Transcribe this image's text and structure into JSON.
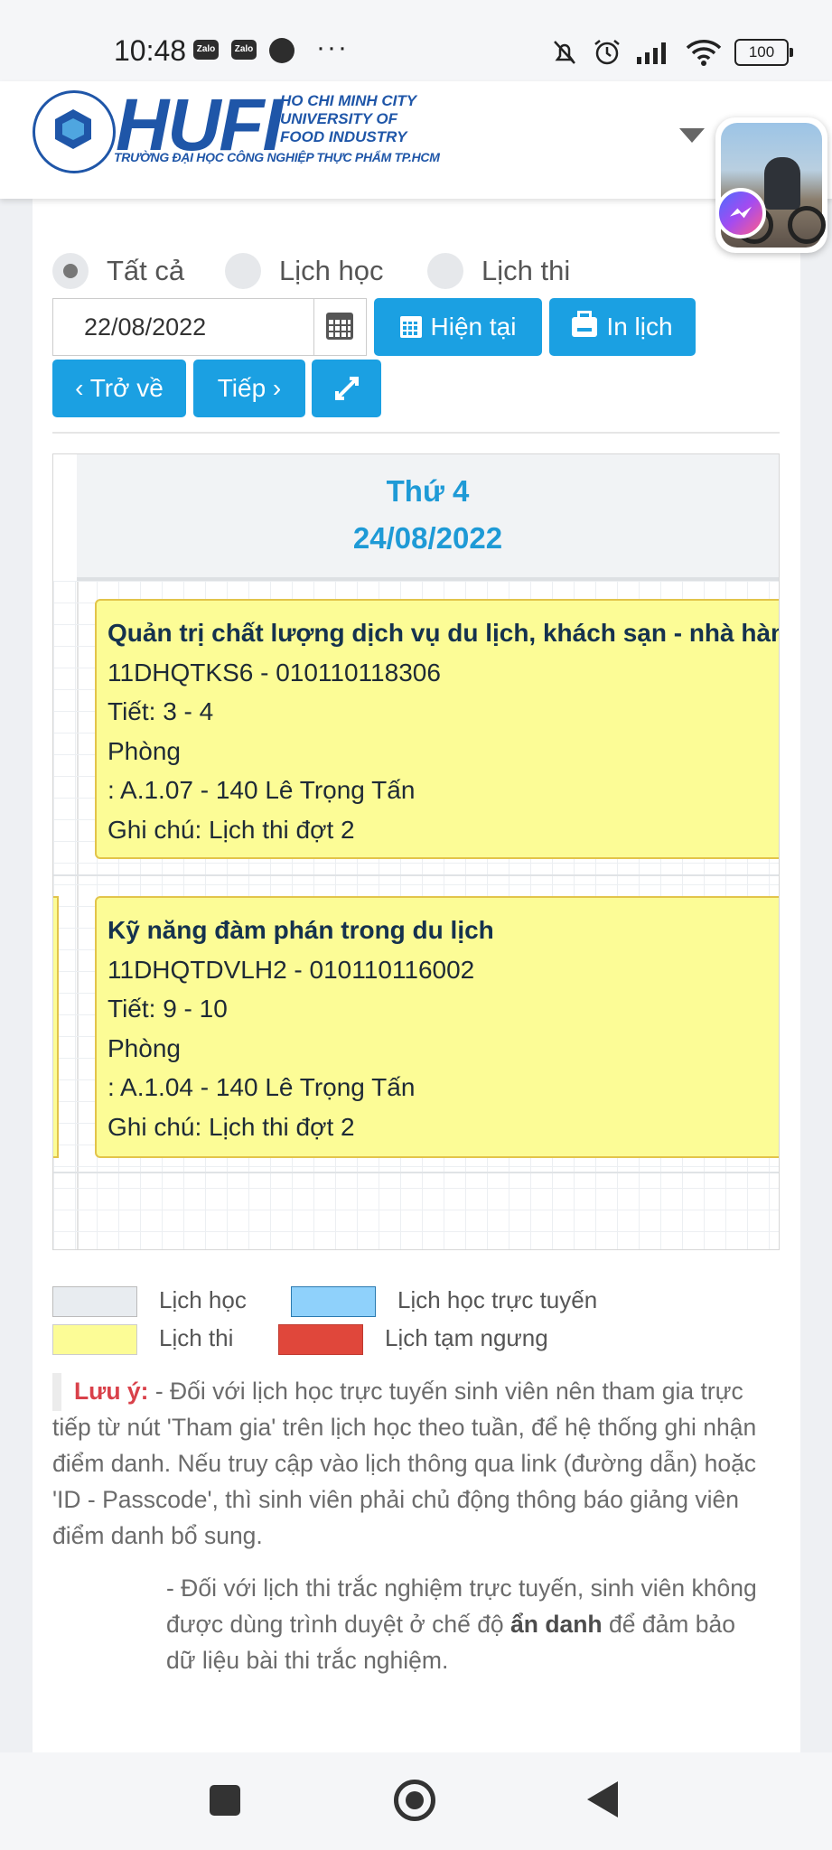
{
  "status_bar": {
    "time": "10:48",
    "app_icons": [
      "Zalo",
      "Zalo"
    ],
    "more": "···",
    "battery": "100"
  },
  "header": {
    "logo_word": "HUFI",
    "logo_en_line1": "HO CHI MINH CITY",
    "logo_en_line2": "UNIVERSITY OF",
    "logo_en_line3": "FOOD INDUSTRY",
    "logo_vn": "TRƯỜNG ĐẠI HỌC CÔNG NGHIỆP THỰC PHẨM TP.HCM"
  },
  "filters": {
    "options": [
      {
        "label": "Tất cả",
        "checked": true
      },
      {
        "label": "Lịch học",
        "checked": false
      },
      {
        "label": "Lịch thi",
        "checked": false
      }
    ]
  },
  "toolbar": {
    "date_value": "22/08/2022",
    "current_label": "Hiện tại",
    "print_label": "In lịch",
    "back_label": "‹ Trở về",
    "next_label": "Tiếp ›"
  },
  "calendar": {
    "day_name": "Thứ 4",
    "day_date": "24/08/2022",
    "events": [
      {
        "title": "Quản trị chất lượng dịch vụ du lịch, khách sạn - nhà hàng",
        "code": "11DHQTKS6 - 010110118306",
        "period": "Tiết: 3 - 4",
        "room_label": "Phòng",
        "room": ": A.1.07 - 140 Lê Trọng Tấn",
        "note": "Ghi chú: Lịch thi đợt 2"
      },
      {
        "title": "Kỹ năng đàm phán trong du lịch",
        "code": "11DHQTDVLH2 - 010110116002",
        "period": "Tiết: 9 - 10",
        "room_label": "Phòng",
        "room": ": A.1.04 - 140 Lê Trọng Tấn",
        "note": "Ghi chú: Lịch thi đợt 2"
      }
    ]
  },
  "legend": {
    "items": [
      {
        "label": "Lịch học",
        "color": "#e8ecf0"
      },
      {
        "label": "Lịch học trực tuyến",
        "color": "#8fd1fb"
      },
      {
        "label": "Lịch thi",
        "color": "#fcfc96"
      },
      {
        "label": "Lịch tạm ngưng",
        "color": "#e0473b"
      }
    ]
  },
  "notes": {
    "label": "Lưu ý:",
    "text1": " - Đối với lịch học trực tuyến sinh viên nên tham gia trực tiếp từ nút 'Tham gia' trên lịch học theo tuần, để hệ thống ghi nhận điểm danh. Nếu truy cập vào lịch thông qua link (đường dẫn) hoặc 'ID - Passcode', thì sinh viên phải chủ động thông báo giảng viên điểm danh bổ sung.",
    "text2_before": "- Đối với lịch thi trắc nghiệm trực tuyến, sinh viên không được dùng trình duyệt ở chế độ ",
    "text2_bold": "ẩn danh",
    "text2_after": " để đảm bảo dữ liệu bài thi trắc nghiệm."
  }
}
